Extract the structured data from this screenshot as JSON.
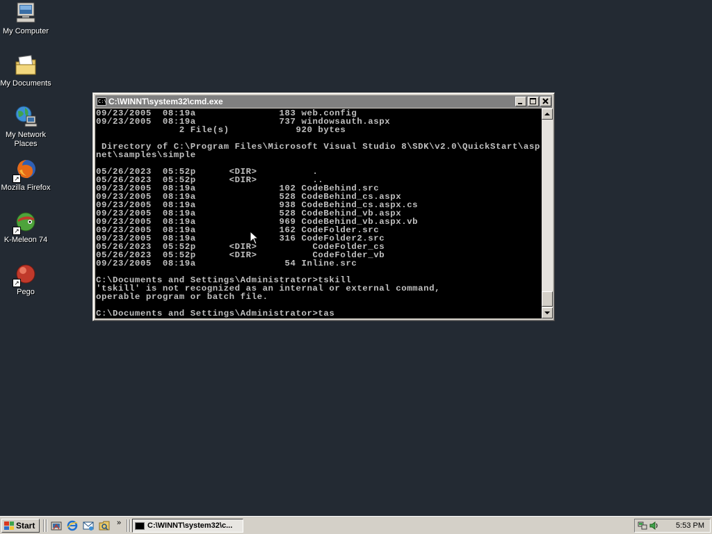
{
  "desktop": {
    "icons": [
      {
        "label_line1": "My Computer",
        "label_line2": "",
        "icon": "computer-icon"
      },
      {
        "label_line1": "My Documents",
        "label_line2": "",
        "icon": "documents-folder-icon"
      },
      {
        "label_line1": "My Network",
        "label_line2": "Places",
        "icon": "network-places-icon"
      },
      {
        "label_line1": "Mozilla Firefox",
        "label_line2": "",
        "icon": "firefox-icon"
      },
      {
        "label_line1": "K-Meleon 74",
        "label_line2": "",
        "icon": "kmeleon-icon"
      },
      {
        "label_line1": "Pego",
        "label_line2": "",
        "icon": "pego-icon"
      }
    ]
  },
  "window": {
    "title": "C:\\WINNT\\system32\\cmd.exe",
    "minimize_label": "_",
    "maximize_label": "□",
    "close_label": "✕"
  },
  "console": {
    "lines": [
      "09/23/2005  08:19a               183 web.config",
      "09/23/2005  08:19a               737 windowsauth.aspx",
      "               2 File(s)            920 bytes",
      "",
      " Directory of C:\\Program Files\\Microsoft Visual Studio 8\\SDK\\v2.0\\QuickStart\\asp",
      "net\\samples\\simple",
      "",
      "05/26/2023  05:52p      <DIR>          .",
      "05/26/2023  05:52p      <DIR>          ..",
      "09/23/2005  08:19a               102 CodeBehind.src",
      "09/23/2005  08:19a               528 CodeBehind_cs.aspx",
      "09/23/2005  08:19a               938 CodeBehind_cs.aspx.cs",
      "09/23/2005  08:19a               528 CodeBehind_vb.aspx",
      "09/23/2005  08:19a               969 CodeBehind_vb.aspx.vb",
      "09/23/2005  08:19a               162 CodeFolder.src",
      "09/23/2005  08:19a               316 CodeFolder2.src",
      "05/26/2023  05:52p      <DIR>          CodeFolder_cs",
      "05/26/2023  05:52p      <DIR>          CodeFolder_vb",
      "09/23/2005  08:19a                54 Inline.src",
      "",
      "C:\\Documents and Settings\\Administrator>tskill",
      "'tskill' is not recognized as an internal or external command,",
      "operable program or batch file.",
      "",
      "C:\\Documents and Settings\\Administrator>tas"
    ]
  },
  "taskbar": {
    "start_label": "Start",
    "quick_launch": [
      "show-desktop-icon",
      "internet-explorer-icon",
      "outlook-express-icon",
      "windows-explorer-icon"
    ],
    "more_label": "»",
    "task_label": "C:\\WINNT\\system32\\c...",
    "clock": "5:53 PM"
  },
  "colors": {
    "desktop": "#232a33",
    "console_bg": "#000000",
    "console_text": "#c0c0c0",
    "titlebar_inactive": "#808080"
  }
}
